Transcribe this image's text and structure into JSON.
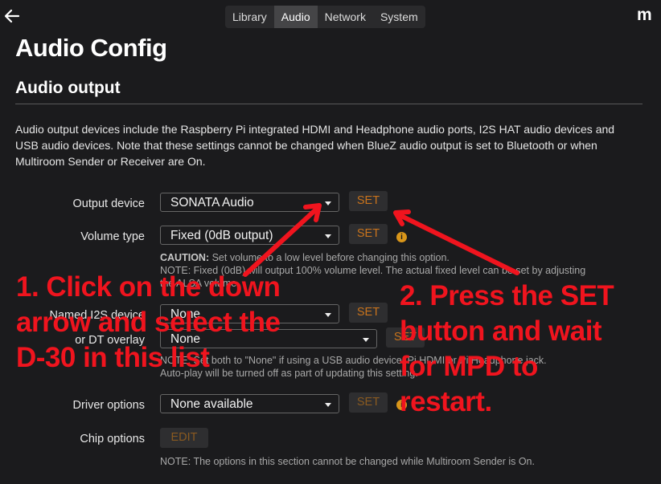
{
  "nav": {
    "tabs": [
      "Library",
      "Audio",
      "Network",
      "System"
    ],
    "active_tab": "Audio",
    "logo": "m"
  },
  "page_title": "Audio Config",
  "section": {
    "title": "Audio output",
    "description": "Audio output devices include the Raspberry Pi integrated HDMI and Headphone audio ports, I2S HAT audio devices and USB audio devices. Note that these settings cannot be changed when BlueZ audio output is set to Bluetooth or when Multiroom Sender or Receiver are On."
  },
  "rows": {
    "output_device": {
      "label": "Output device",
      "value": "SONATA Audio",
      "button": "SET"
    },
    "volume_type": {
      "label": "Volume type",
      "value": "Fixed (0dB output)",
      "button": "SET"
    },
    "volume_note": {
      "caution_label": "CAUTION:",
      "caution_text": " Set volume to a low level before changing this option.",
      "note_text": "NOTE: Fixed (0dB) will output 100% volume level. The actual fixed level can be set by adjusting",
      "note_tail": "the ALSA volume."
    },
    "named_i2s": {
      "label": "Named I2S device",
      "value": "None",
      "button": "SET"
    },
    "dt_overlay": {
      "label": "or DT overlay",
      "value": "None",
      "button": "SET"
    },
    "i2s_note": {
      "line1": "NOTE: Set both to \"None\" if using a USB audio device, Pi HDMI or Pi Headphone jack.",
      "line2": "Auto-play will be turned off as part of updating this setting."
    },
    "driver_options": {
      "label": "Driver options",
      "value": "None available",
      "button": "SET"
    },
    "chip_options": {
      "label": "Chip options",
      "button": "EDIT"
    },
    "footer_note": "NOTE: The options in this section cannot be changed while Multiroom Sender is On."
  },
  "annotations": {
    "left": [
      "1. Click on the down",
      "arrow and select the",
      "D-30 in this list"
    ],
    "right": [
      "2. Press the SET",
      "button and wait",
      "for MPD to",
      "restart."
    ],
    "color": "#f0141e"
  },
  "colors": {
    "background": "#1b1b1d",
    "set_button_text": "#c8731c",
    "info_icon": "#d9961a"
  },
  "icons": {
    "back": "arrow-left-icon",
    "info": "info-icon",
    "caret": "chevron-down-icon"
  }
}
